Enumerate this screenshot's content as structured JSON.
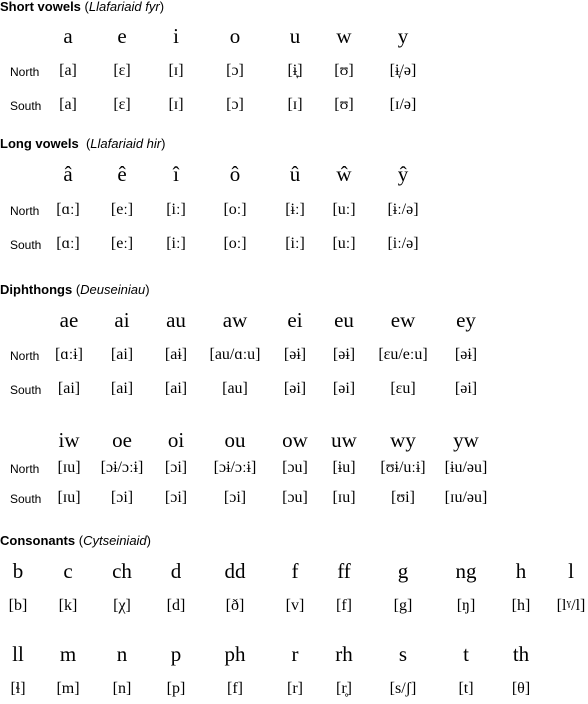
{
  "sections": {
    "short_vowels": {
      "title": "Short vowels",
      "subtitle": "Llafariaid fyr",
      "letters": [
        "a",
        "e",
        "i",
        "o",
        "u",
        "w",
        "y"
      ],
      "north_label": "North",
      "south_label": "South",
      "north": [
        "[a]",
        "[ɛ]",
        "[ɪ]",
        "[ɔ]",
        "[ɨ̞]",
        "[ʊ]",
        "[ɨ̞/ə]"
      ],
      "south": [
        "[a]",
        "[ɛ]",
        "[ɪ]",
        "[ɔ]",
        "[ɪ]",
        "[ʊ]",
        "[ɪ/ə]"
      ]
    },
    "long_vowels": {
      "title": "Long vowels",
      "subtitle": "Llafariaid hir",
      "letters": [
        "â",
        "ê",
        "î",
        "ô",
        "û",
        "ŵ",
        "ŷ"
      ],
      "north_label": "North",
      "south_label": "South",
      "north": [
        "[ɑː]",
        "[eː]",
        "[iː]",
        "[oː]",
        "[ɨː]",
        "[uː]",
        "[ɨː/ə]"
      ],
      "south": [
        "[ɑː]",
        "[eː]",
        "[iː]",
        "[oː]",
        "[iː]",
        "[uː]",
        "[iː/ə]"
      ]
    },
    "diphthongs": {
      "title": "Diphthongs",
      "subtitle": "Deuseiniau",
      "north_label": "North",
      "south_label": "South",
      "group1": {
        "letters": [
          "ae",
          "ai",
          "au",
          "aw",
          "ei",
          "eu",
          "ew",
          "ey"
        ],
        "north": [
          "[ɑːɨ]",
          "[ai]",
          "[aɨ]",
          "[au/ɑːu]",
          "[əɨ]",
          "[əɨ]",
          "[ɛu/eːu]",
          "[əɨ]"
        ],
        "south": [
          "[ai]",
          "[ai]",
          "[ai]",
          "[au]",
          "[əi]",
          "[əi]",
          "[ɛu]",
          "[əi]"
        ]
      },
      "group2": {
        "letters": [
          "iw",
          "oe",
          "oi",
          "ou",
          "ow",
          "uw",
          "wy",
          "yw"
        ],
        "north": [
          "[ɪu]",
          "[ɔɨ/ɔːɨ]",
          "[ɔi]",
          "[ɔɨ/ɔːɨ]",
          "[ɔu]",
          "[ɨu]",
          "[ʊɨ/uːɨ]",
          "[ɨu/əu]"
        ],
        "south": [
          "[ɪu]",
          "[ɔi]",
          "[ɔi]",
          "[ɔi]",
          "[ɔu]",
          "[ɪu]",
          "[ʊi]",
          "[ɪu/əu]"
        ]
      }
    },
    "consonants": {
      "title": "Consonants",
      "subtitle": "Cytseiniaid",
      "row1": {
        "letters": [
          "b",
          "c",
          "ch",
          "d",
          "dd",
          "f",
          "ff",
          "g",
          "ng",
          "h",
          "l"
        ],
        "ipa": [
          "[b]",
          "[k]",
          "[χ]",
          "[d]",
          "[ð]",
          "[v]",
          "[f]",
          "[g]",
          "[ŋ]",
          "[h]",
          "[lˠ/l]"
        ]
      },
      "row2": {
        "letters": [
          "ll",
          "m",
          "n",
          "p",
          "ph",
          "r",
          "rh",
          "s",
          "t",
          "th"
        ],
        "ipa": [
          "[ɬ]",
          "[m]",
          "[n]",
          "[p]",
          "[f]",
          "[r]",
          "[r̥]",
          "[s/ʃ]",
          "[t]",
          "[θ]"
        ]
      }
    }
  }
}
